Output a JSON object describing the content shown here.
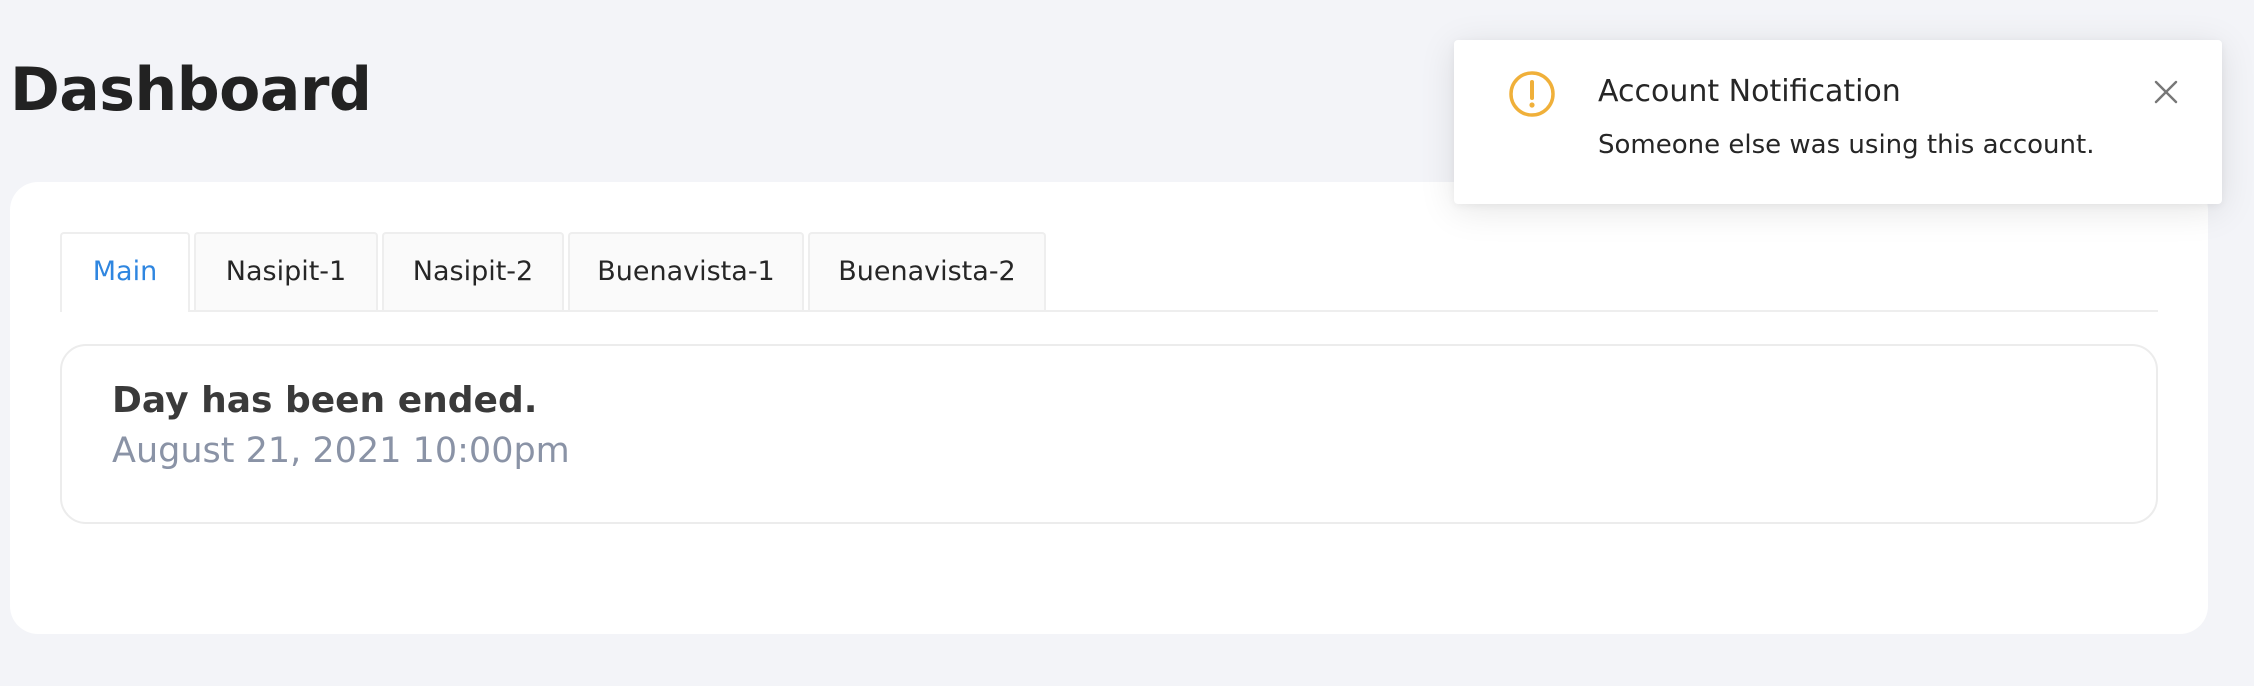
{
  "page": {
    "title": "Dashboard"
  },
  "tabs": [
    {
      "label": "Main",
      "active": true
    },
    {
      "label": "Nasipit-1",
      "active": false
    },
    {
      "label": "Nasipit-2",
      "active": false
    },
    {
      "label": "Buenavista-1",
      "active": false
    },
    {
      "label": "Buenavista-2",
      "active": false
    }
  ],
  "status": {
    "heading": "Day has been ended.",
    "datetime": "August 21, 2021 10:00pm"
  },
  "notification": {
    "icon": "warning-icon",
    "title": "Account Notification",
    "message": "Someone else was using this account.",
    "close_icon": "close-icon"
  },
  "colors": {
    "accent": "#2f86e0",
    "warning": "#f0b03a",
    "background": "#f3f4f8",
    "muted_text": "#8a93a6"
  }
}
